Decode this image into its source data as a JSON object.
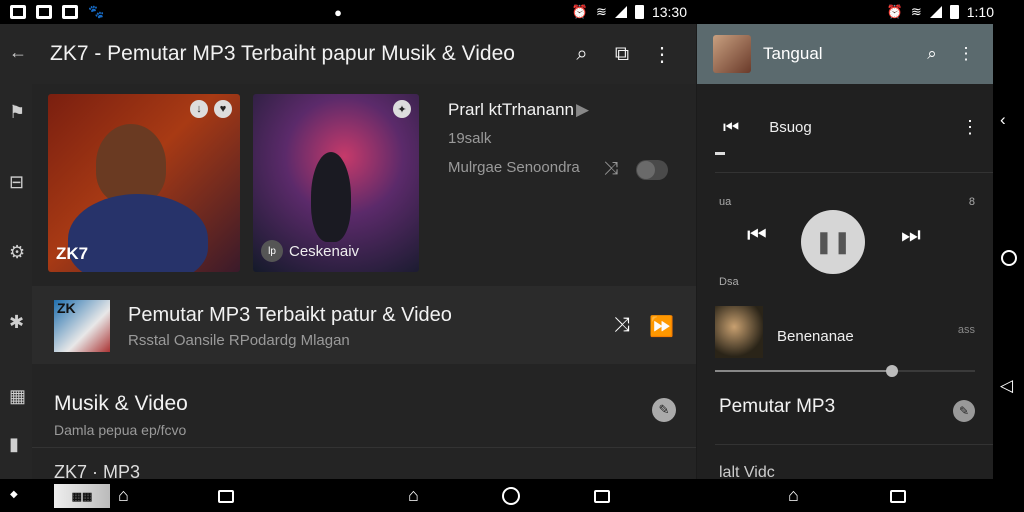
{
  "status_left": {
    "time": "13:30"
  },
  "status_right": {
    "time": "1:10"
  },
  "main": {
    "title": "ZK7 - Pemutar MP3 Terbaiht papur Musik & Video",
    "card1_label": "ZK7",
    "card2_label": "Ceskenaiv",
    "card2_badge": "lp",
    "feature": {
      "title": "Prarl ktTrhanann",
      "count": "19salk",
      "sub": "Mulrgae Senoondra"
    },
    "row1": {
      "thumb_text": "ZK",
      "title": "Pemutar MP3 Terbaikt patur & Video",
      "sub": "Rsstal Oansile RPodardg Mlagan"
    },
    "row2": {
      "title": "Musik & Video",
      "sub": "Damla pepua ep/fcvo"
    },
    "row3": "ZK7 · MP3"
  },
  "side": {
    "title": "Tangual",
    "now_playing": "Bsuog",
    "time_left": "ua",
    "time_right": "8",
    "queue_label": "Dsa",
    "queue_item": "Benenanae",
    "queue_badge": "ass",
    "slider_value": 0.68,
    "row2": "Pemutar MP3",
    "row3": "lalt Vidc"
  },
  "icons": {
    "back": "arrow-left-icon",
    "search": "search-icon",
    "cast": "cast-icon",
    "more": "more-vert-icon",
    "shuffle": "shuffle-icon",
    "fast_forward": "fast-forward-icon",
    "prev": "skip-previous-icon",
    "next": "skip-next-icon",
    "pause": "pause-icon"
  },
  "colors": {
    "background": "#242424",
    "side_header": "#5b6a6e",
    "accent": "#d6d6d6"
  }
}
